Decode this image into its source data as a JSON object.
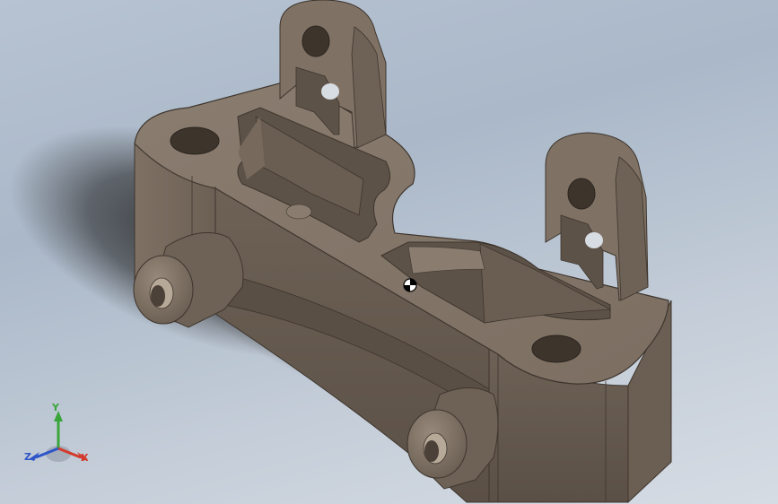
{
  "viewport": {
    "background_top": "#b7c3d2",
    "background_bottom": "#d6dce4",
    "part_color": "#7a6d60"
  },
  "triad": {
    "x_label": "X",
    "y_label": "Y",
    "z_label": "Z",
    "x_color": "#d33a2c",
    "y_color": "#3aa53a",
    "z_color": "#2f55c8"
  },
  "icons": {
    "origin": "center-of-mass-icon"
  }
}
